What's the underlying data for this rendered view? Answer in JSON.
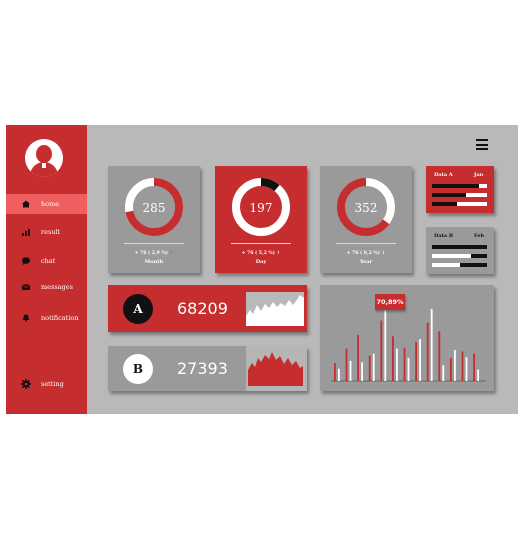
{
  "sidebar": {
    "items": [
      {
        "label": "home",
        "icon": "home-icon",
        "active": true
      },
      {
        "label": "result",
        "icon": "bar-chart-icon",
        "active": false
      },
      {
        "label": "chat",
        "icon": "chat-bubble-icon",
        "active": false
      },
      {
        "label": "messages",
        "icon": "envelope-icon",
        "active": false
      },
      {
        "label": "notification",
        "icon": "bell-icon",
        "active": false
      },
      {
        "label": "setting",
        "icon": "gear-icon",
        "active": false
      }
    ]
  },
  "kpis": [
    {
      "value": "285",
      "change": "+ 76 ( 2,9 %)",
      "arrow": "↑",
      "period": "Month",
      "progress": 0.72
    },
    {
      "value": "197",
      "change": "+ 76 ( 5,2 %)",
      "arrow": "↑",
      "period": "Day",
      "progress": 0.9
    },
    {
      "value": "352",
      "change": "+ 76 ( 8,2 %)",
      "arrow": "↓",
      "period": "Year",
      "progress": 0.35
    }
  ],
  "mini_cards": [
    {
      "title": "Data A",
      "month": "Jan",
      "bars": [
        0.85,
        0.62,
        0.45
      ]
    },
    {
      "title": "Data B",
      "month": "Feb",
      "bars": [
        0.85,
        0.7,
        0.5
      ]
    }
  ],
  "summaries": [
    {
      "badge": "A",
      "value": "68209"
    },
    {
      "badge": "B",
      "value": "27393"
    }
  ],
  "chart": {
    "tooltip": "70,89%",
    "values_red": [
      25,
      45,
      64,
      35,
      84,
      62,
      46,
      54,
      81,
      69,
      32,
      41,
      38
    ],
    "values_white": [
      17,
      28,
      26,
      38,
      98,
      45,
      32,
      58,
      100,
      22,
      43,
      33,
      16
    ],
    "colors": {
      "red": "#c62d2f",
      "white": "#ffffff"
    }
  },
  "colors": {
    "accent": "#c62d2f",
    "highlight": "#ef5f60",
    "panel": "#9a9a9a",
    "background": "#b9b9b9"
  }
}
